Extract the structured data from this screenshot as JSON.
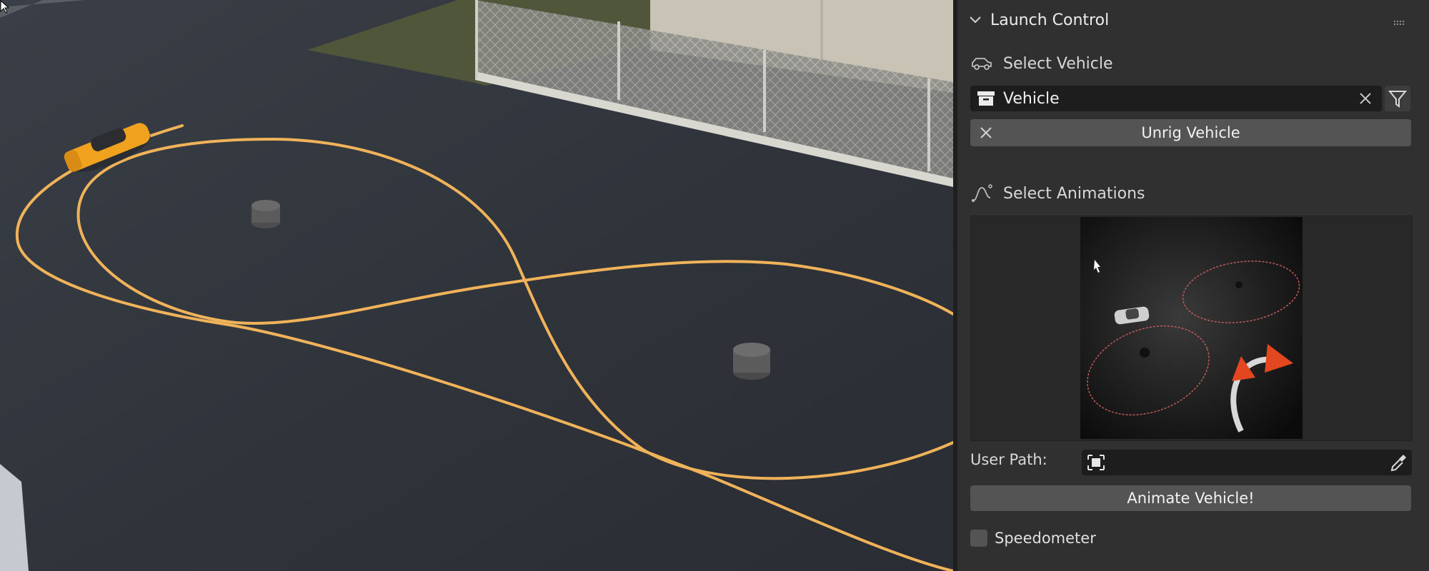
{
  "panel": {
    "header": {
      "title": "Launch Control",
      "chevron_icon": "chevron-down-icon",
      "grip_icon": "drag-grip-icon"
    },
    "select_vehicle": {
      "label": "Select Vehicle",
      "icon": "car-outline-icon"
    },
    "vehicle_field": {
      "value": "Vehicle",
      "icon": "collection-box-icon",
      "clear_icon": "close-icon",
      "filter_icon": "filter-icon"
    },
    "unrig_button": {
      "label": "Unrig Vehicle",
      "icon": "close-icon"
    },
    "select_animations": {
      "label": "Select Animations",
      "icon": "curve-path-icon"
    },
    "animation_preview": {
      "description_icon": "figure-eight-drift-preview"
    },
    "user_path": {
      "label": "User Path:",
      "value": "",
      "object_icon": "object-box-icon",
      "picker_icon": "eyedropper-icon"
    },
    "animate_button": {
      "label": "Animate Vehicle!"
    },
    "speedometer": {
      "label": "Speedometer",
      "checked": false
    }
  },
  "colors": {
    "panel_bg": "#303030",
    "field_bg": "#1d1d1d",
    "button_bg": "#545454",
    "path_line": "#f0b35a",
    "vehicle": "#f0a21e",
    "arrow_accent": "#e2471f"
  }
}
